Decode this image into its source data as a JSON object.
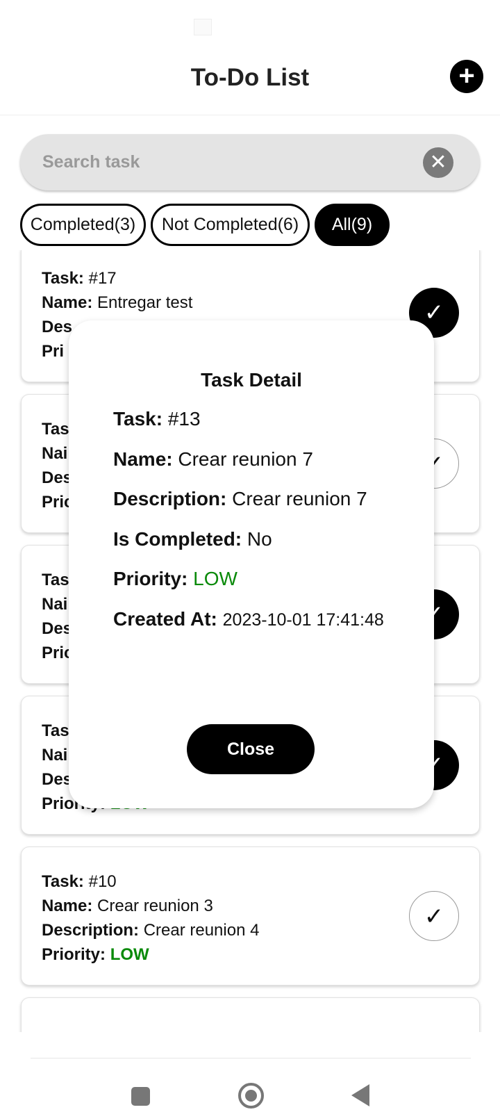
{
  "header": {
    "title": "To-Do List",
    "add_icon": "plus-icon",
    "add_symbol": "+"
  },
  "search": {
    "placeholder": "Search task",
    "clear_symbol": "✕"
  },
  "filters": [
    {
      "label": "Completed(3)",
      "active": false
    },
    {
      "label": "Not Completed(6)",
      "active": false
    },
    {
      "label": "All(9)",
      "active": true
    }
  ],
  "labels": {
    "task": "Task:",
    "name": "Name:",
    "description": "Description:",
    "priority": "Priority:"
  },
  "tasks": [
    {
      "task": "#17",
      "name": "Entregar test",
      "description": "Des",
      "priority": "Pri",
      "completed": true
    },
    {
      "task": "Tas",
      "name": "Nai",
      "description": "Des",
      "priority": "Pric",
      "completed": false
    },
    {
      "task": "Tas",
      "name": "Nai",
      "description": "Des",
      "priority": "Pric",
      "completed": true
    },
    {
      "task": "Tas",
      "name": "Nai",
      "description": "Des",
      "priority": "LOW",
      "completed": true
    },
    {
      "task": "#10",
      "name": "Crear reunion 3",
      "description": "Crear reunion 4",
      "priority": "LOW",
      "completed": false
    }
  ],
  "check_symbol": "✓",
  "modal": {
    "title": "Task Detail",
    "task_label": "Task:",
    "task_value": "#13",
    "name_label": "Name:",
    "name_value": "Crear reunion 7",
    "description_label": "Description:",
    "description_value": "Crear reunion 7",
    "completed_label": "Is Completed:",
    "completed_value": "No",
    "priority_label": "Priority:",
    "priority_value": "LOW",
    "created_label": "Created At:",
    "created_value": "2023-10-01 17:41:48",
    "close_label": "Close"
  },
  "colors": {
    "priority_low": "#0a8a0a",
    "accent": "#000000"
  }
}
